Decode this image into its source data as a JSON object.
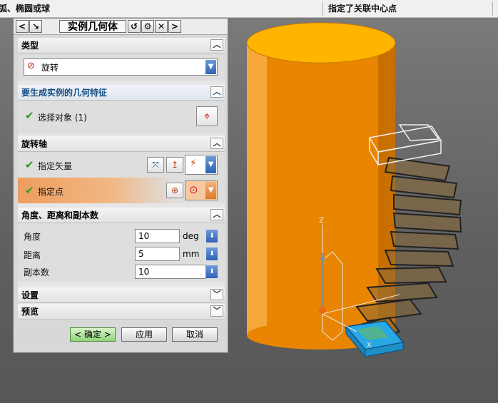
{
  "statusbar": {
    "left_text": "弧、椭圆或球",
    "right_text": "指定了关联中心点"
  },
  "dialog": {
    "title": "实例几何体",
    "title_buttons": {
      "back": "<",
      "arrow": "↘",
      "reset": "↺",
      "settings": "⚙",
      "close": "✕",
      "next": ">"
    },
    "sections": {
      "type": {
        "header": "类型",
        "value": "旋转"
      },
      "geometry": {
        "header": "要生成实例的几何特征",
        "select_label": "选择对象 (1)"
      },
      "axis": {
        "header": "旋转轴",
        "vector_label": "指定矢量",
        "point_label": "指定点"
      },
      "params": {
        "header": "角度、距离和副本数",
        "angle_label": "角度",
        "angle_value": "10",
        "angle_unit": "deg",
        "distance_label": "距离",
        "distance_value": "5",
        "distance_unit": "mm",
        "copies_label": "副本数",
        "copies_value": "10"
      },
      "settings": {
        "header": "设置"
      },
      "preview": {
        "header": "预览"
      }
    },
    "buttons": {
      "ok": "< 确定 >",
      "apply": "应用",
      "cancel": "取消"
    }
  },
  "viewport": {
    "axis_z": "Z",
    "axis_x": "X"
  },
  "colors": {
    "cylinder_top": "#ffb400",
    "cylinder_side": "#e98500",
    "selection_highlight": "#f0a060",
    "step_blue": "#29a8e6",
    "chevron_blue": "#164e84"
  }
}
